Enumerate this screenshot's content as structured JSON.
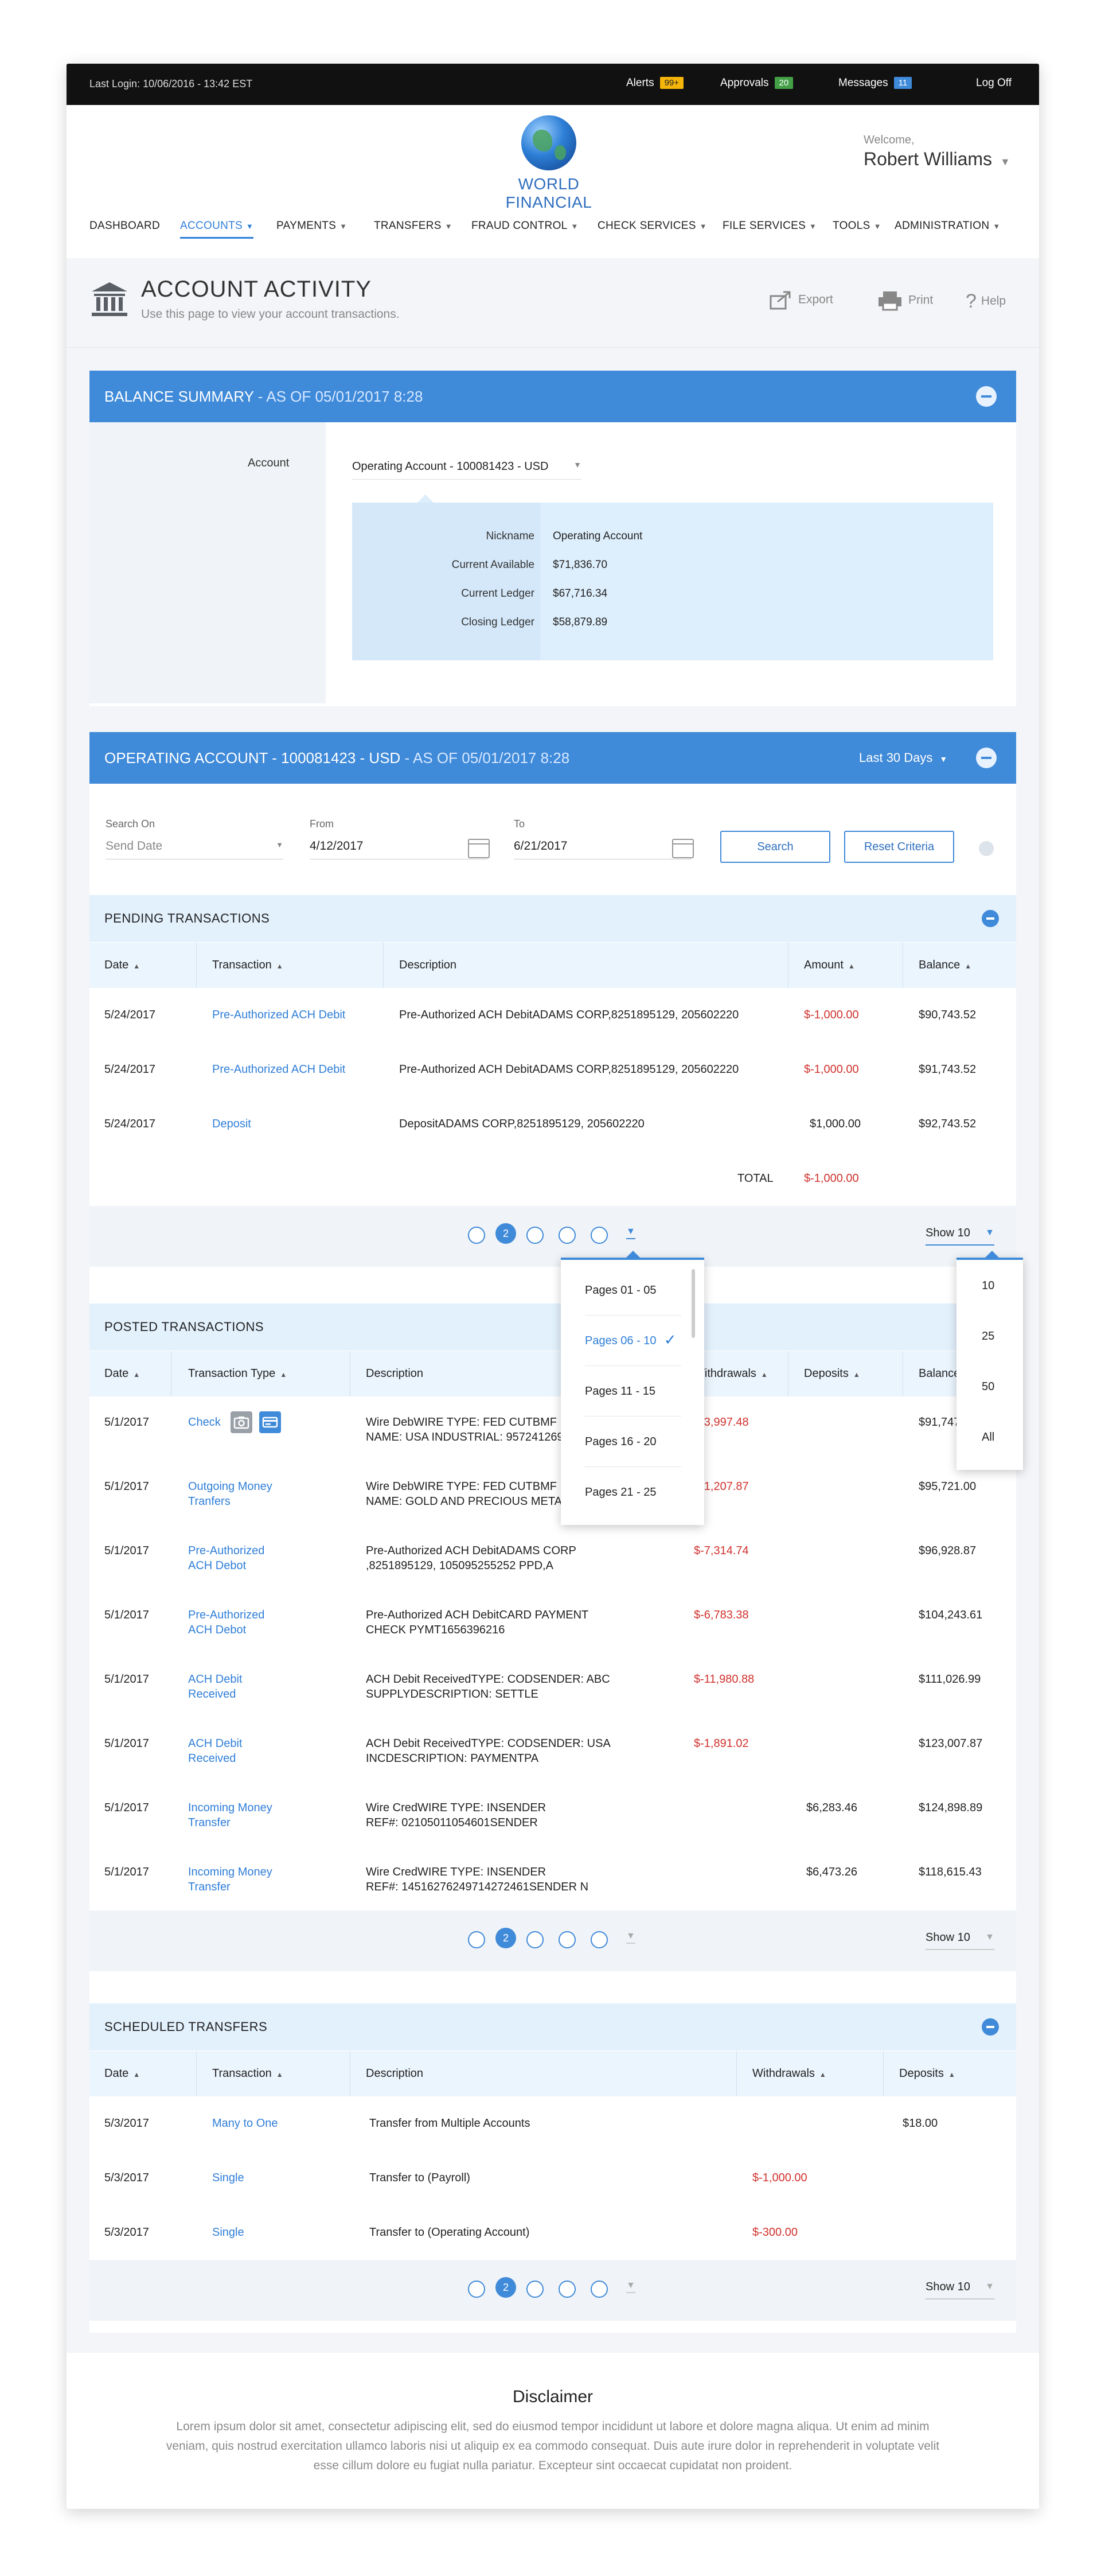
{
  "topbar": {
    "last_login": "Last Login: 10/06/2016 - 13:42 EST",
    "alerts_label": "Alerts",
    "alerts_count": "99+",
    "approvals_label": "Approvals",
    "approvals_count": "20",
    "messages_label": "Messages",
    "messages_count": "11",
    "logoff": "Log Off",
    "colors": {
      "alerts": "#f5b50a",
      "approvals": "#43a047",
      "messages": "#3f8ad9"
    }
  },
  "header": {
    "logo_text": "WORLD FINANCIAL",
    "welcome": "Welcome,",
    "user_name": "Robert Williams"
  },
  "nav": {
    "items": [
      {
        "label": "DASHBOARD",
        "has_caret": false
      },
      {
        "label": "ACCOUNTS",
        "has_caret": true,
        "active": true
      },
      {
        "label": "PAYMENTS",
        "has_caret": true
      },
      {
        "label": "TRANSFERS",
        "has_caret": true
      },
      {
        "label": "FRAUD CONTROL",
        "has_caret": true
      },
      {
        "label": "CHECK SERVICES",
        "has_caret": true
      },
      {
        "label": "FILE SERVICES",
        "has_caret": true
      },
      {
        "label": "TOOLS",
        "has_caret": true
      },
      {
        "label": "ADMINISTRATION",
        "has_caret": true
      }
    ]
  },
  "page_header": {
    "title": "ACCOUNT ACTIVITY",
    "subtitle": "Use this page to view your account transactions.",
    "export": "Export",
    "print": "Print",
    "help": "Help",
    "icons": [
      "bank-icon",
      "export-icon",
      "print-icon",
      "help-icon"
    ]
  },
  "balance_summary": {
    "title": "BALANCE SUMMARY",
    "as_of": " - AS OF 05/01/2017  8:28",
    "account_label": "Account",
    "account_value": "Operating Account - 100081423 - USD",
    "rows": [
      {
        "label": "Nickname",
        "value": "Operating Account"
      },
      {
        "label": "Current Available",
        "value": "$71,836.70"
      },
      {
        "label": "Current Ledger",
        "value": "$67,716.34"
      },
      {
        "label": "Closing Ledger",
        "value": "$58,879.89"
      }
    ]
  },
  "operating_account": {
    "title": "OPERATING ACCOUNT - 100081423 - USD",
    "as_of": " - AS OF 05/01/2017  8:28",
    "range": "Last 30 Days",
    "search_on_label": "Search On",
    "search_on_placeholder": "Send Date",
    "from_label": "From",
    "from_value": "4/12/2017",
    "to_label": "To",
    "to_value": "6/21/2017",
    "search_button": "Search",
    "reset_button": "Reset Criteria"
  },
  "pending": {
    "title": "PENDING TRANSACTIONS",
    "columns": [
      "Date",
      "Transaction",
      "Description",
      "Amount",
      "Balance"
    ],
    "rows": [
      {
        "date": "5/24/2017",
        "transaction": "Pre-Authorized ACH Debit",
        "description": "Pre-Authorized ACH DebitADAMS CORP,8251895129, 205602220",
        "amount": "$-1,000.00",
        "balance": "$90,743.52"
      },
      {
        "date": "5/24/2017",
        "transaction": "Pre-Authorized ACH Debit",
        "description": "Pre-Authorized ACH DebitADAMS CORP,8251895129, 205602220",
        "amount": "$-1,000.00",
        "balance": "$91,743.52"
      },
      {
        "date": "5/24/2017",
        "transaction": "Deposit",
        "description": "DepositADAMS CORP,8251895129, 205602220",
        "amount": "$1,000.00",
        "balance": "$92,743.52"
      }
    ],
    "total_label": "TOTAL",
    "total_value": "$-1,000.00",
    "current_page": "2",
    "show_label": "Show 10"
  },
  "pages_dropdown": {
    "items": [
      "Pages 01 - 05",
      "Pages 06 - 10",
      "Pages 11 - 15",
      "Pages 16 - 20",
      "Pages 21 - 25"
    ],
    "selected": "Pages 06 - 10"
  },
  "show_dropdown": {
    "items": [
      "10",
      "25",
      "50",
      "All"
    ]
  },
  "posted": {
    "title": "POSTED TRANSACTIONS",
    "columns": [
      "Date",
      "Transaction Type",
      "Description",
      "Withdrawals",
      "Deposits",
      "Balance"
    ],
    "rows": [
      {
        "date": "5/1/2017",
        "type": "Check",
        "desc1": "Wire DebWIRE TYPE: FED CUTBMF",
        "desc2": "NAME: USA INDUSTRIAL: 9572412697",
        "withdrawal": "$-3,997.48",
        "deposit": "",
        "balance": "$91,747.00"
      },
      {
        "date": "5/1/2017",
        "type1": "Outgoing Money",
        "type2": "Tranfers",
        "desc1": "Wire DebWIRE TYPE: FED CUTBMF",
        "desc2": "NAME: GOLD AND PRECIOUS METALS",
        "withdrawal": "$-1,207.87",
        "deposit": "",
        "balance": "$95,721.00"
      },
      {
        "date": "5/1/2017",
        "type1": "Pre-Authorized",
        "type2": "ACH Debot",
        "desc1": "Pre-Authorized ACH DebitADAMS CORP",
        "desc2": ",8251895129, 105095255252 PPD,A",
        "withdrawal": "$-7,314.74",
        "deposit": "",
        "balance": "$96,928.87"
      },
      {
        "date": "5/1/2017",
        "type1": "Pre-Authorized",
        "type2": "ACH Debot",
        "desc1": "Pre-Authorized ACH DebitCARD PAYMENT",
        "desc2": "CHECK PYMT1656396216",
        "withdrawal": "$-6,783.38",
        "deposit": "",
        "balance": "$104,243.61"
      },
      {
        "date": "5/1/2017",
        "type1": "ACH Debit",
        "type2": "Received",
        "desc1": "ACH Debit ReceivedTYPE: CODSENDER: ABC",
        "desc2": "SUPPLYDESCRIPTION: SETTLE",
        "withdrawal": "$-11,980.88",
        "deposit": "",
        "balance": "$111,026.99"
      },
      {
        "date": "5/1/2017",
        "type1": "ACH Debit",
        "type2": "Received",
        "desc1": "ACH Debit ReceivedTYPE: CODSENDER: USA",
        "desc2": "INCDESCRIPTION: PAYMENTPA",
        "withdrawal": "$-1,891.02",
        "deposit": "",
        "balance": "$123,007.87"
      },
      {
        "date": "5/1/2017",
        "type1": "Incoming Money",
        "type2": "Transfer",
        "desc1": "Wire CredWIRE TYPE: INSENDER",
        "desc2": "REF#: 02105011054601SENDER",
        "withdrawal": "",
        "deposit": "$6,283.46",
        "balance": "$124,898.89"
      },
      {
        "date": "5/1/2017",
        "type1": "Incoming Money",
        "type2": "Transfer",
        "desc1": "Wire CredWIRE TYPE: INSENDER",
        "desc2": "REF#: 14516276249714272461SENDER N",
        "withdrawal": "",
        "deposit": "$6,473.26",
        "balance": "$118,615.43"
      }
    ],
    "current_page": "2",
    "show_label": "Show 10"
  },
  "scheduled": {
    "title": "SCHEDULED TRANSFERS",
    "columns": [
      "Date",
      "Transaction",
      "Description",
      "Withdrawals",
      "Deposits"
    ],
    "rows": [
      {
        "date": "5/3/2017",
        "transaction": "Many to One",
        "description": "Transfer from Multiple Accounts",
        "withdrawal": "",
        "deposit": "$18.00"
      },
      {
        "date": "5/3/2017",
        "transaction": "Single",
        "description": "Transfer to (Payroll)",
        "withdrawal": "$-1,000.00",
        "deposit": ""
      },
      {
        "date": "5/3/2017",
        "transaction": "Single",
        "description": "Transfer to (Operating Account)",
        "withdrawal": "$-300.00",
        "deposit": ""
      }
    ],
    "current_page": "2",
    "show_label": "Show 10"
  },
  "disclaimer": {
    "title": "Disclaimer",
    "text": "Lorem ipsum dolor sit amet, consectetur adipiscing elit, sed do eiusmod tempor incididunt ut labore et dolore magna aliqua. Ut enim ad minim veniam, quis nostrud exercitation ullamco laboris nisi ut aliquip ex ea commodo consequat. Duis aute irure dolor in reprehenderit in voluptate velit esse cillum dolore eu fugiat nulla pariatur. Excepteur sint occaecat cupidatat non proident."
  },
  "theme": {
    "accent": "#3f8ad9",
    "negative": "#d0312d",
    "link": "#2f7ed8"
  }
}
